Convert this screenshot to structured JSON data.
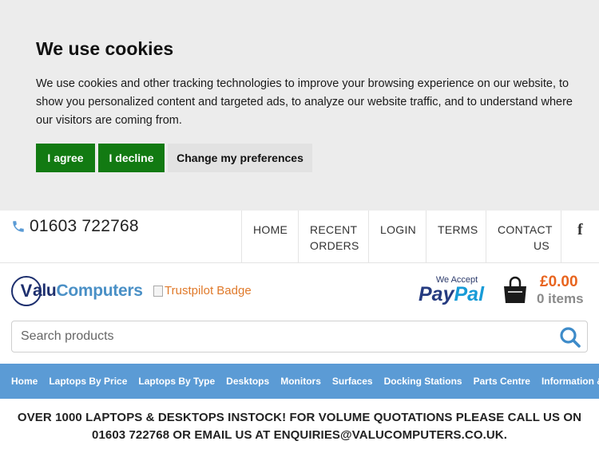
{
  "cookie": {
    "title": "We use cookies",
    "text": "We use cookies and other tracking technologies to improve your browsing experience on our website, to show you personalized content and targeted ads, to analyze our website traffic, and to understand where our visitors are coming from.",
    "agree": "I agree",
    "decline": "I decline",
    "preferences": "Change my preferences"
  },
  "topbar": {
    "phone": "01603 722768",
    "nav": {
      "home": "HOME",
      "recent_line1": "RECENT",
      "recent_line2": "ORDERS",
      "login": "LOGIN",
      "terms": "TERMS",
      "contact_line1": "CONTACT",
      "contact_line2": "US"
    },
    "social_icon": "facebook-icon"
  },
  "brand": {
    "logo_initial": "V",
    "logo_part1": "alu",
    "logo_part2": "Computers",
    "trustpilot_alt": "Trustpilot Badge",
    "paypal_tagline": "We Accept",
    "paypal_part1": "Pay",
    "paypal_part2": "Pal"
  },
  "cart": {
    "total": "£0.00",
    "items": "0 items"
  },
  "search": {
    "placeholder": "Search products"
  },
  "mainnav": [
    "Home",
    "Laptops By Price",
    "Laptops By Type",
    "Desktops",
    "Monitors",
    "Surfaces",
    "Docking Stations",
    "Parts Centre",
    "Information & Sup"
  ],
  "notice": "OVER 1000 LAPTOPS & DESKTOPS INSTOCK! FOR VOLUME QUOTATIONS PLEASE CALL US ON 01603 722768 OR EMAIL US AT ENQUIRIES@VALUCOMPUTERS.CO.UK.",
  "colors": {
    "accept_green": "#127a12",
    "nav_blue": "#5b9bd5",
    "price_orange": "#e8641e",
    "brand_navy": "#1d2f6e"
  }
}
